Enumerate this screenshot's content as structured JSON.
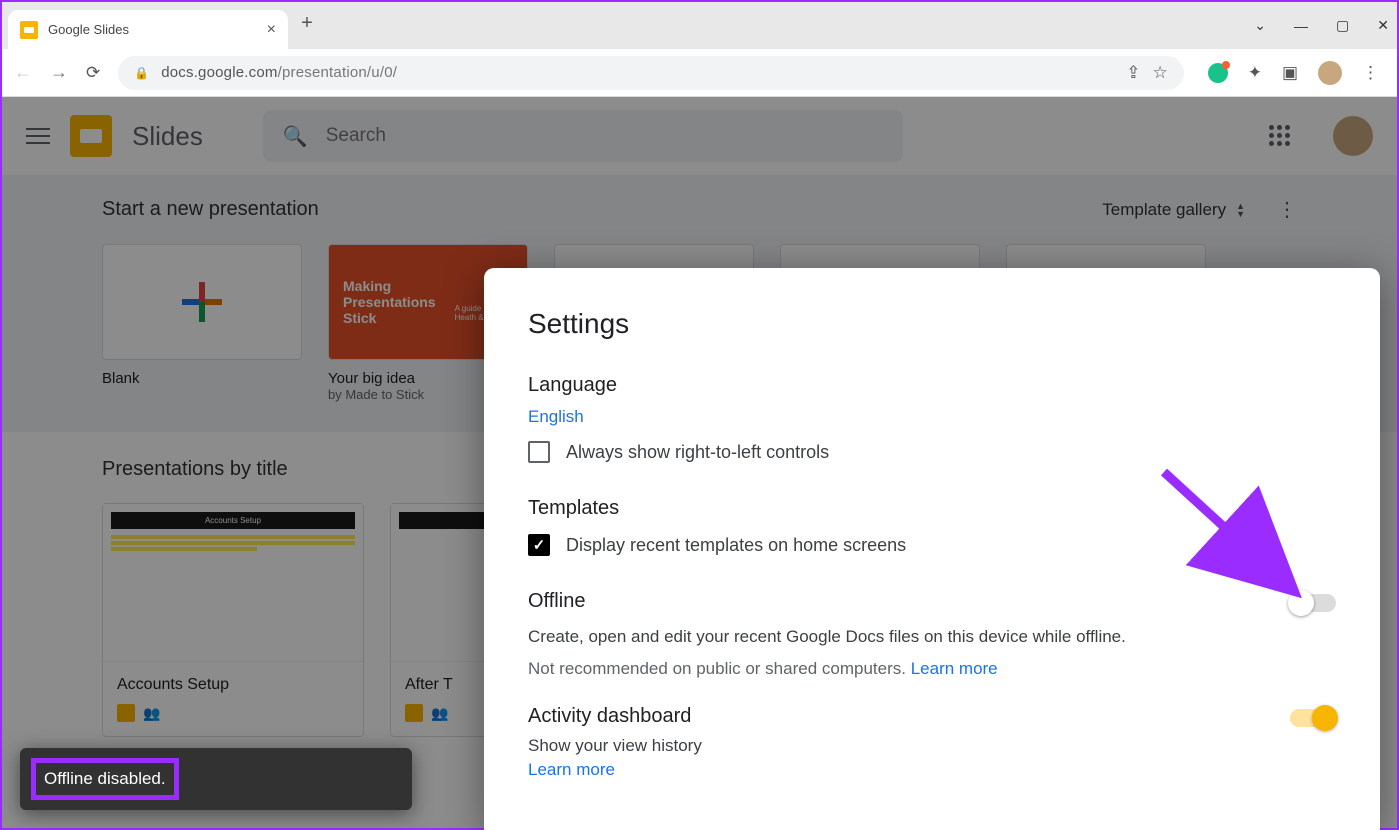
{
  "browser": {
    "tab_title": "Google Slides",
    "url_host": "docs.google.com",
    "url_path": "/presentation/u/0/",
    "new_tab": "+",
    "close_tab": "×",
    "win_min": "—",
    "win_max": "▢",
    "win_close": "✕",
    "win_chev": "⌄"
  },
  "app": {
    "brand": "Slides",
    "search_placeholder": "Search",
    "start_heading": "Start a new presentation",
    "template_gallery": "Template gallery",
    "templates": {
      "blank": "Blank",
      "big_idea": "Your big idea",
      "big_idea_sub": "by Made to Stick",
      "orange_t1": "Making Presentations Stick",
      "orange_t2": "A guide by Chip Heath & D"
    },
    "presentations_heading": "Presentations by title",
    "cards": {
      "c1": "Accounts Setup",
      "c1_bar": "Accounts Setup",
      "c2": "After T"
    }
  },
  "settings": {
    "title": "Settings",
    "language_h": "Language",
    "language_value": "English",
    "rtl_label": "Always show right-to-left controls",
    "templates_h": "Templates",
    "templates_label": "Display recent templates on home screens",
    "offline_h": "Offline",
    "offline_desc": "Create, open and edit your recent Google Docs files on this device while offline.",
    "offline_note": "Not recommended on public or shared computers. ",
    "learn_more": "Learn more",
    "activity_h": "Activity dashboard",
    "activity_desc": "Show your view history"
  },
  "toast": {
    "message": "Offline disabled."
  }
}
